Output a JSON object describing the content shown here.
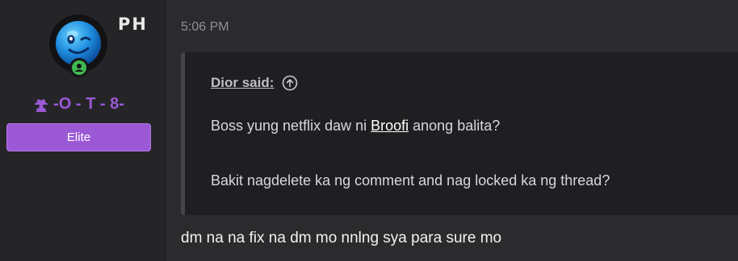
{
  "user": {
    "country": "PH",
    "username": "-O - T - 8-",
    "badge": "Elite",
    "avatar_icon": "winking-blue-smiley-icon",
    "status_icon": "online-user-icon",
    "username_icon": "spy-icon",
    "accent_color": "#9b59d6"
  },
  "post": {
    "time": "5:06 PM",
    "quote": {
      "author_label": "Dior said:",
      "jump_icon": "arrow-up-circle-icon",
      "line1_before": "Boss yung netflix daw ni ",
      "line1_mention": "Broofi",
      "line1_after": " anong balita?",
      "line2": "Bakit nagdelete ka ng comment and nag locked ka ng thread?"
    },
    "reply": "dm na na fix na dm mo nnlng sya para sure mo"
  }
}
